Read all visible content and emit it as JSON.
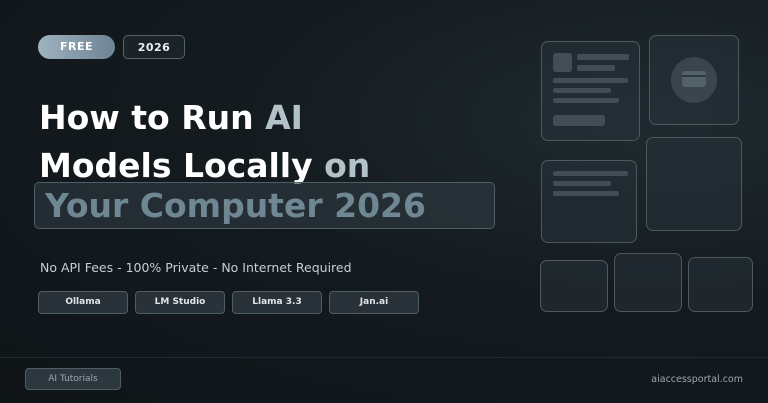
{
  "badges": {
    "free": "FREE",
    "year": "2026"
  },
  "headline": {
    "line1_plain": "How to Run ",
    "line1_accent": "AI",
    "line2_plain": "Models Locally ",
    "line2_accent": "on",
    "line3": "Your Computer 2026"
  },
  "subtitle": "No API Fees - 100% Private - No Internet Required",
  "tags": [
    "Ollama",
    "LM Studio",
    "Llama 3.3",
    "Jan.ai"
  ],
  "footer": {
    "category": "AI Tutorials",
    "site": "aiaccessportal.com"
  },
  "colors": {
    "background": "#141b1f",
    "accent_text": "#b3c1c9",
    "highlight_text": "#6e8793",
    "free_badge": "#8fa3b1"
  },
  "illustration_icons": [
    "window-card-icon",
    "storage-icon"
  ]
}
